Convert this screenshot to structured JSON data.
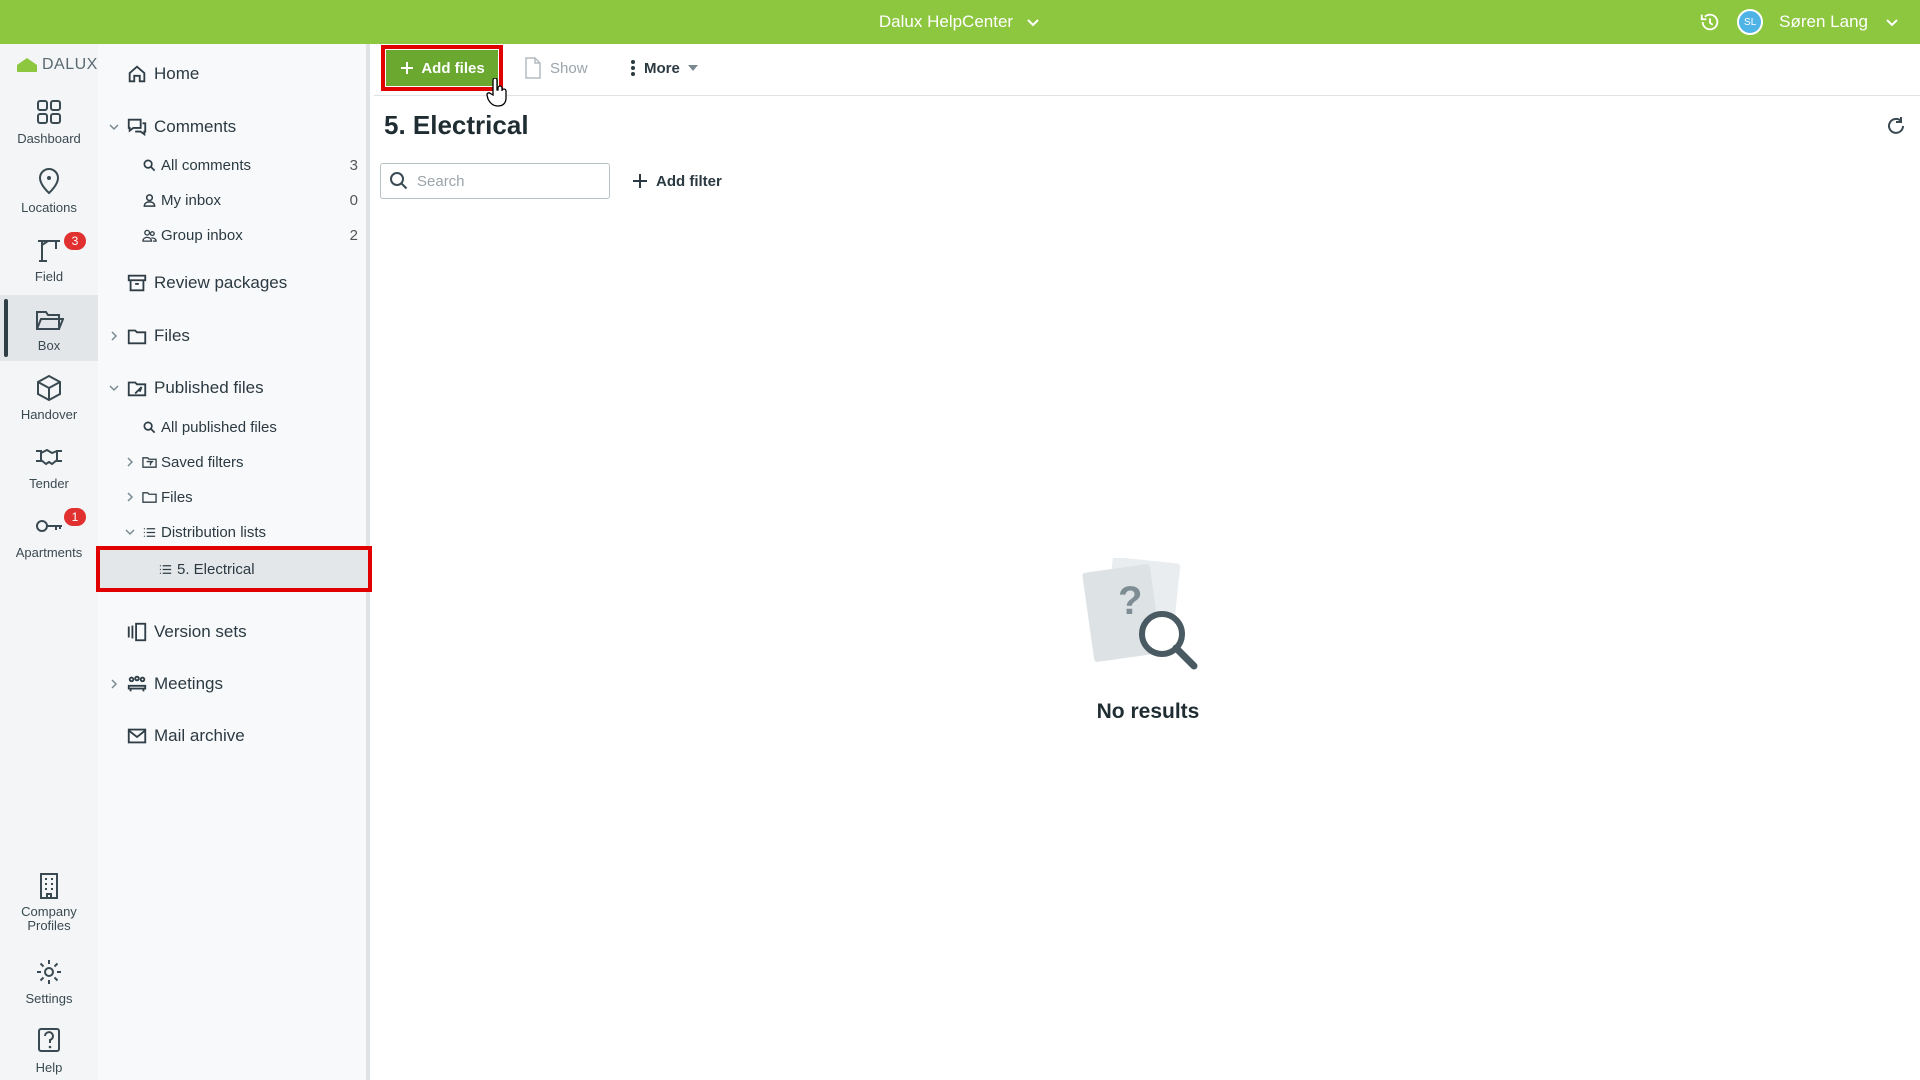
{
  "topbar": {
    "project_name": "Dalux HelpCenter",
    "avatar_initials": "SL",
    "user_name": "Søren Lang"
  },
  "rail": {
    "logo_text": "DALUX",
    "items": [
      {
        "label": "Dashboard",
        "icon": "dashboard-icon"
      },
      {
        "label": "Locations",
        "icon": "location-pin-icon"
      },
      {
        "label": "Field",
        "icon": "crane-icon",
        "badge": "3"
      },
      {
        "label": "Box",
        "icon": "folder-open-icon",
        "active": true
      },
      {
        "label": "Handover",
        "icon": "package-icon"
      },
      {
        "label": "Tender",
        "icon": "handshake-icon"
      },
      {
        "label": "Apartments",
        "icon": "key-icon",
        "badge": "1"
      }
    ],
    "bottom_items": [
      {
        "label": "Company\nProfiles",
        "icon": "building-icon"
      },
      {
        "label": "Settings",
        "icon": "gear-icon"
      },
      {
        "label": "Help",
        "icon": "help-icon"
      }
    ]
  },
  "nav": {
    "home": "Home",
    "comments": "Comments",
    "all_comments": "All comments",
    "all_comments_count": "3",
    "my_inbox": "My inbox",
    "my_inbox_count": "0",
    "group_inbox": "Group inbox",
    "group_inbox_count": "2",
    "review_packages": "Review packages",
    "files": "Files",
    "published_files": "Published files",
    "all_published_files": "All published files",
    "saved_filters": "Saved filters",
    "pub_files": "Files",
    "distribution_lists": "Distribution lists",
    "electrical": "5. Electrical",
    "version_sets": "Version sets",
    "meetings": "Meetings",
    "mail_archive": "Mail archive"
  },
  "toolbar": {
    "add_files": "Add files",
    "show": "Show",
    "more": "More"
  },
  "main": {
    "title": "5. Electrical",
    "search_placeholder": "Search",
    "add_filter": "Add filter",
    "empty_text": "No results"
  }
}
